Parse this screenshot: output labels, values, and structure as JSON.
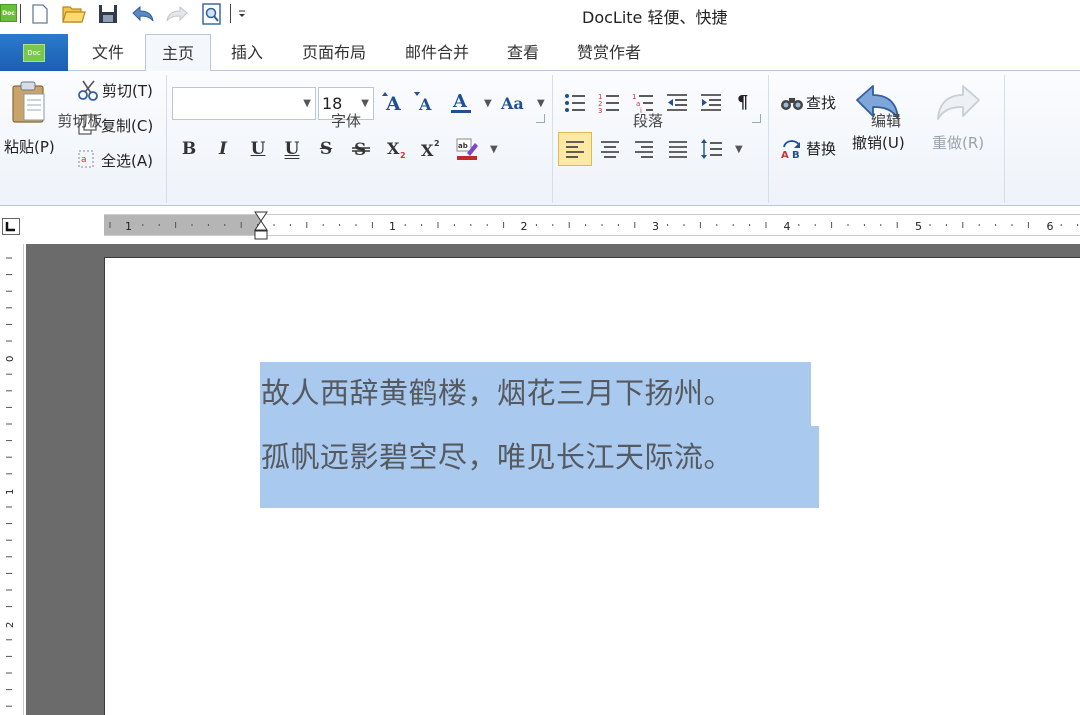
{
  "app": {
    "title": "DocLite  轻便、快捷",
    "logo_text": "Doc"
  },
  "quick_access": [
    "new-icon",
    "open-icon",
    "save-icon",
    "undo-icon",
    "redo-icon",
    "print-preview-icon",
    "customize-icon"
  ],
  "tabs": [
    {
      "label": "文件"
    },
    {
      "label": "主页",
      "active": true
    },
    {
      "label": "插入"
    },
    {
      "label": "页面布局"
    },
    {
      "label": "邮件合并"
    },
    {
      "label": "查看"
    },
    {
      "label": "赞赏作者"
    }
  ],
  "clipboard": {
    "group_label": "剪切板",
    "paste": "粘贴(P)",
    "cut": "剪切(T)",
    "copy": "复制(C)",
    "select_all": "全选(A)"
  },
  "font": {
    "group_label": "字体",
    "family_value": "",
    "size_value": "18",
    "buttons": [
      "grow-font",
      "shrink-font",
      "font-color",
      "change-case",
      "bold",
      "italic",
      "underline",
      "double-underline",
      "strikethrough",
      "double-strikethrough",
      "subscript",
      "superscript",
      "highlight"
    ]
  },
  "paragraph": {
    "group_label": "段落",
    "buttons": [
      "bullets",
      "numbering",
      "multilevel-list",
      "decrease-indent",
      "increase-indent",
      "show-marks",
      "align-left",
      "align-center",
      "align-right",
      "justify",
      "line-spacing"
    ]
  },
  "editing": {
    "group_label": "编辑",
    "find": "查找",
    "replace": "替换",
    "undo": "撤销(U)",
    "redo": "重做(R)"
  },
  "ruler": {
    "numbers": [
      "1",
      "1",
      "2",
      "3",
      "4",
      "5",
      "6"
    ],
    "vertical_numbers": [
      "0",
      "1",
      "2"
    ]
  },
  "document": {
    "lines": [
      "故人西辞黄鹤楼，烟花三月下扬州。",
      "孤帆远影碧空尽，唯见长江天际流。"
    ]
  },
  "colors": {
    "selection": "#a9c9ee",
    "file_tab": "#1c5fb0",
    "workspace": "#6b6b6b",
    "accent_blue": "#2a6fc9"
  }
}
